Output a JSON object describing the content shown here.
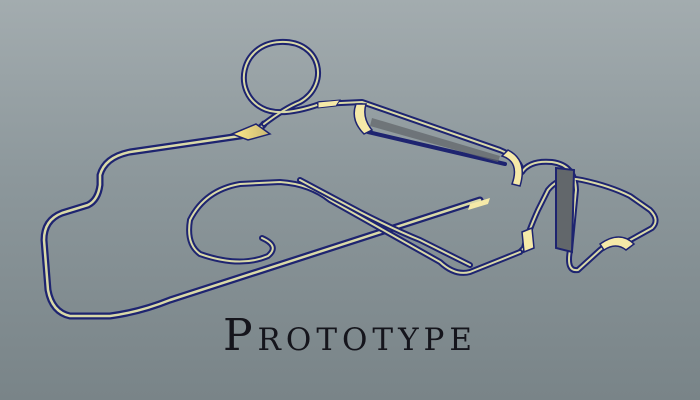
{
  "track": {
    "title": "Prototype",
    "colors": {
      "rail": "#1e2470",
      "highlight": "#f5e9a8",
      "surface": "#d9d9a8",
      "underside": "#5f6468",
      "background_top": "#a3acaf",
      "background_bottom": "#798488"
    }
  }
}
